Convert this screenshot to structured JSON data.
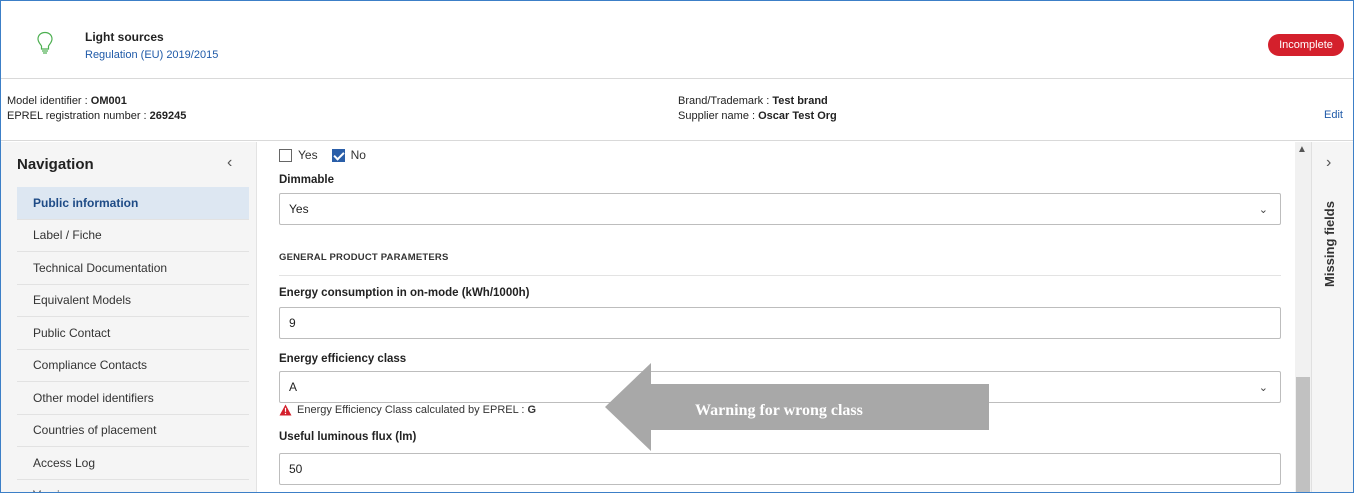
{
  "product": {
    "title": "Light sources",
    "regulation": "Regulation (EU) 2019/2015",
    "status": "Incomplete"
  },
  "info": {
    "model_identifier_label": "Model identifier : ",
    "model_identifier_value": "OM001",
    "eprel_label": "EPREL registration number : ",
    "eprel_value": "269245",
    "brand_label": "Brand/Trademark : ",
    "brand_value": "Test brand",
    "supplier_label": "Supplier name : ",
    "supplier_value": "Oscar Test Org",
    "edit_label": "Edit"
  },
  "navigation": {
    "title": "Navigation",
    "items": [
      {
        "label": "Public information",
        "active": true
      },
      {
        "label": "Label / Fiche"
      },
      {
        "label": "Technical Documentation"
      },
      {
        "label": "Equivalent Models"
      },
      {
        "label": "Public Contact"
      },
      {
        "label": "Compliance Contacts"
      },
      {
        "label": "Other model identifiers"
      },
      {
        "label": "Countries of placement"
      },
      {
        "label": "Access Log"
      },
      {
        "label": "Versions"
      }
    ]
  },
  "form": {
    "yes_label": "Yes",
    "no_label": "No",
    "selected_option": "No",
    "dimmable": {
      "label": "Dimmable",
      "value": "Yes"
    },
    "section_heading": "GENERAL PRODUCT PARAMETERS",
    "energy_consumption": {
      "label": "Energy consumption in on-mode (kWh/1000h)",
      "value": "9"
    },
    "energy_class": {
      "label": "Energy efficiency class",
      "value": "A"
    },
    "warning": {
      "text": "Energy Efficiency Class calculated by EPREL :",
      "value": "G"
    },
    "luminous_flux": {
      "label": "Useful luminous flux (lm)",
      "value": "50"
    }
  },
  "missing_fields": {
    "label": "Missing fields"
  },
  "annotation": {
    "text": "Warning for wrong class"
  },
  "colors": {
    "accent": "#1f5aa8",
    "status": "#d4202c",
    "active_nav_bg": "#dde7f2",
    "annotation_arrow": "#a8a8a8"
  },
  "icons": {
    "product": "lightbulb-icon",
    "warning": "warning-triangle-icon",
    "dropdown": "chevron-down-icon",
    "nav_collapse": "chevron-left-icon",
    "panel_expand": "chevron-right-icon"
  }
}
